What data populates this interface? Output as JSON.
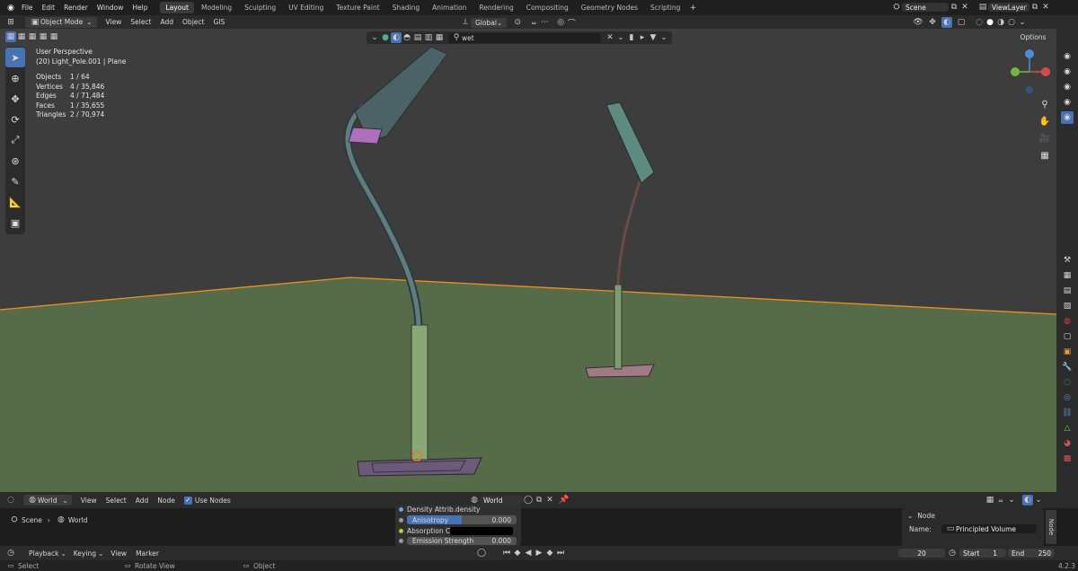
{
  "menu": [
    "File",
    "Edit",
    "Render",
    "Window",
    "Help"
  ],
  "workspaces": [
    "Layout",
    "Modeling",
    "Sculpting",
    "UV Editing",
    "Texture Paint",
    "Shading",
    "Animation",
    "Rendering",
    "Compositing",
    "Geometry Nodes",
    "Scripting"
  ],
  "active_workspace": "Layout",
  "scene": "Scene",
  "view_layer": "ViewLayer",
  "header": {
    "mode": "Object Mode",
    "menus": [
      "View",
      "Select",
      "Add",
      "Object",
      "GIS"
    ],
    "orientation": "Global",
    "search_value": "wet",
    "options": "Options"
  },
  "viewport": {
    "perspective": "User Perspective",
    "object": "(20) Light_Pole.001 | Plane",
    "stats": [
      {
        "k": "Objects",
        "v": "1 / 64"
      },
      {
        "k": "Vertices",
        "v": "4 / 35,846"
      },
      {
        "k": "Edges",
        "v": "4 / 71,484"
      },
      {
        "k": "Faces",
        "v": "1 / 35,655"
      },
      {
        "k": "Triangles",
        "v": "2 / 70,974"
      }
    ]
  },
  "node_editor": {
    "world_type": "World",
    "menus": [
      "View",
      "Select",
      "Add",
      "Node"
    ],
    "use_nodes": "Use Nodes",
    "world_name": "World",
    "breadcrumb": [
      "Scene",
      "World"
    ],
    "rows": [
      {
        "label": "Density Attrib...",
        "value": "density"
      },
      {
        "label": "Anisotropy",
        "value": "0.000"
      },
      {
        "label": "Absorption C...",
        "value": ""
      },
      {
        "label": "Emission Strength",
        "value": "0.000"
      }
    ],
    "node_tab": "Node",
    "node_panel_title": "Node",
    "name_label": "Name:",
    "name_value": "Principled Volume"
  },
  "timeline": {
    "menus": [
      "Playback",
      "Keying",
      "View",
      "Marker"
    ],
    "current_frame": "20",
    "start_label": "Start",
    "start": "1",
    "end_label": "End",
    "end": "250"
  },
  "status": {
    "select": "Select",
    "rotate": "Rotate View",
    "object": "Object",
    "version": "4.2.3"
  },
  "colors": {
    "accent": "#4772b3",
    "viewport_bg": "#3d3d3d",
    "ground": "#566b47",
    "outline": "#f0901e"
  }
}
